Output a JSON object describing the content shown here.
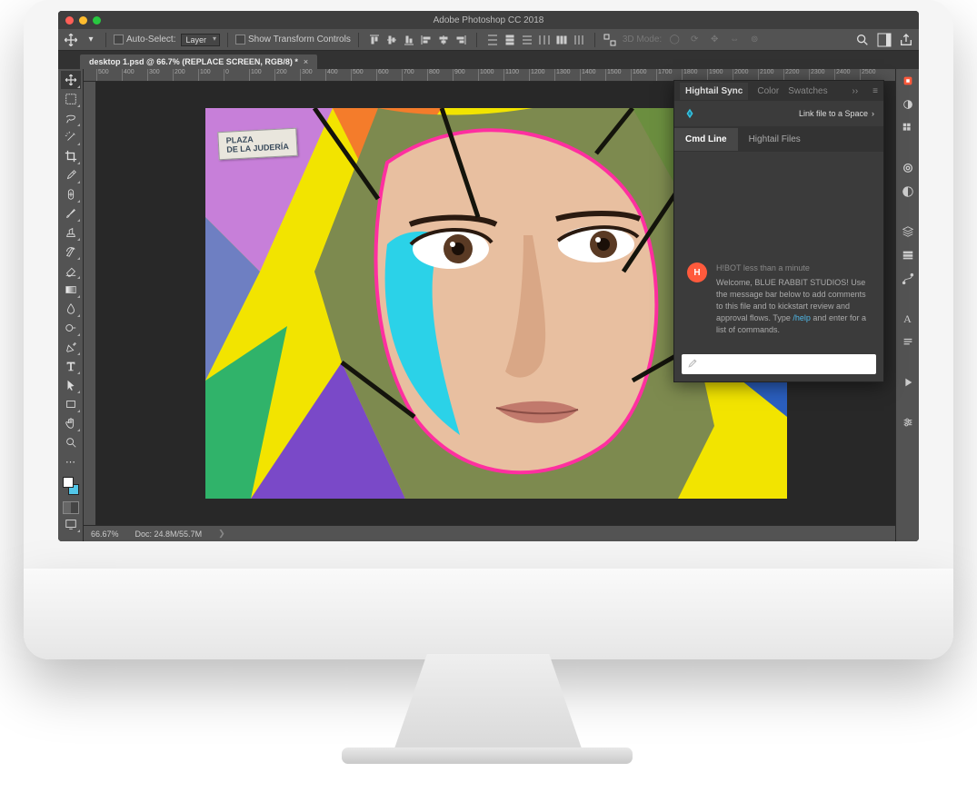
{
  "window": {
    "title": "Adobe Photoshop CC 2018"
  },
  "options_bar": {
    "auto_select_label": "Auto-Select:",
    "auto_select_dropdown": "Layer",
    "show_transform_label": "Show Transform Controls",
    "mode_3d_label": "3D Mode:"
  },
  "top_right": {},
  "document_tab": {
    "label": "desktop 1.psd @ 66.7% (REPLACE SCREEN, RGB/8) *"
  },
  "ruler_marks": [
    "500",
    "400",
    "300",
    "200",
    "100",
    "0",
    "100",
    "200",
    "300",
    "400",
    "500",
    "600",
    "700",
    "800",
    "900",
    "1000",
    "1100",
    "1200",
    "1300",
    "1400",
    "1500",
    "1600",
    "1700",
    "1800",
    "1900",
    "2000",
    "2100",
    "2200",
    "2300",
    "2400",
    "2500"
  ],
  "artwork": {
    "plaque_line1": "PLAZA",
    "plaque_line2": "DE LA JUDERÍA"
  },
  "status_bar": {
    "zoom": "66.67%",
    "doc_info": "Doc: 24.8M/55.7M"
  },
  "panel": {
    "tabs": [
      "Hightail Sync",
      "Color",
      "Swatches"
    ],
    "link_label": "Link file to a Space",
    "subtabs": {
      "cmd": "Cmd Line",
      "files": "Hightail Files"
    },
    "message": {
      "avatar_initial": "H",
      "header": "H!BOT less than a minute",
      "body_pre": "Welcome, BLUE RABBIT STUDIOS! Use the message bar below to add comments to this file and to kickstart review and approval flows. Type ",
      "body_link": "/help",
      "body_post": " and enter for a list of commands."
    },
    "input_placeholder": ""
  }
}
